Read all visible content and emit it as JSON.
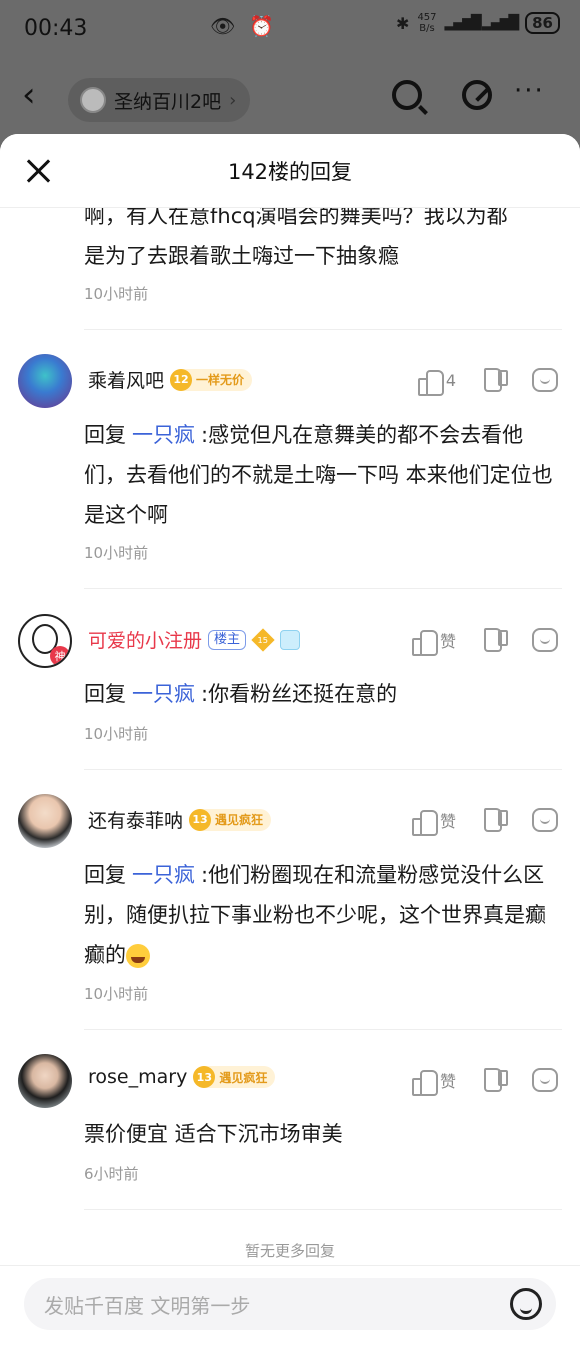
{
  "status_bar": {
    "time": "00:43",
    "speed": "457",
    "speed_unit": "B/s",
    "battery": "86"
  },
  "underlying_header": {
    "forum_name": "圣纳百川2吧"
  },
  "sheet": {
    "title": "142楼的回复"
  },
  "truncated_comment": {
    "text_line1": "啊，有人在意fhcq演唱会的舞美吗？我以为都",
    "text_line2": "是为了去跟着歌土嗨过一下抽象瘾",
    "time": "10小时前"
  },
  "comments": [
    {
      "username": "乘着风吧",
      "level": "12",
      "level_title": "一样无价",
      "likes": "4",
      "reply_prefix": "回复",
      "mention": "一只疯",
      "text": ":感觉但凡在意舞美的都不会去看他们，去看他们的不就是土嗨一下吗 本来他们定位也是这个啊",
      "time": "10小时前"
    },
    {
      "username": "可爱的小注册",
      "owner_tag": "楼主",
      "level": "15",
      "avatar_badge": "神",
      "likes": "赞",
      "reply_prefix": "回复",
      "mention": "一只疯",
      "text": ":你看粉丝还挺在意的",
      "time": "10小时前"
    },
    {
      "username": "还有泰菲呐",
      "level": "13",
      "level_title": "遇见疯狂",
      "likes": "赞",
      "reply_prefix": "回复",
      "mention": "一只疯",
      "text": ":他们粉圈现在和流量粉感觉没什么区别，随便扒拉下事业粉也不少呢，这个世界真是癫癫的",
      "time": "10小时前"
    },
    {
      "username": "rose_mary",
      "level": "13",
      "level_title": "遇见疯狂",
      "likes": "赞",
      "text": "票价便宜 适合下沉市场审美",
      "time": "6小时前"
    }
  ],
  "no_more_text": "暂无更多回复",
  "input": {
    "placeholder": "发贴千百度 文明第一步"
  }
}
